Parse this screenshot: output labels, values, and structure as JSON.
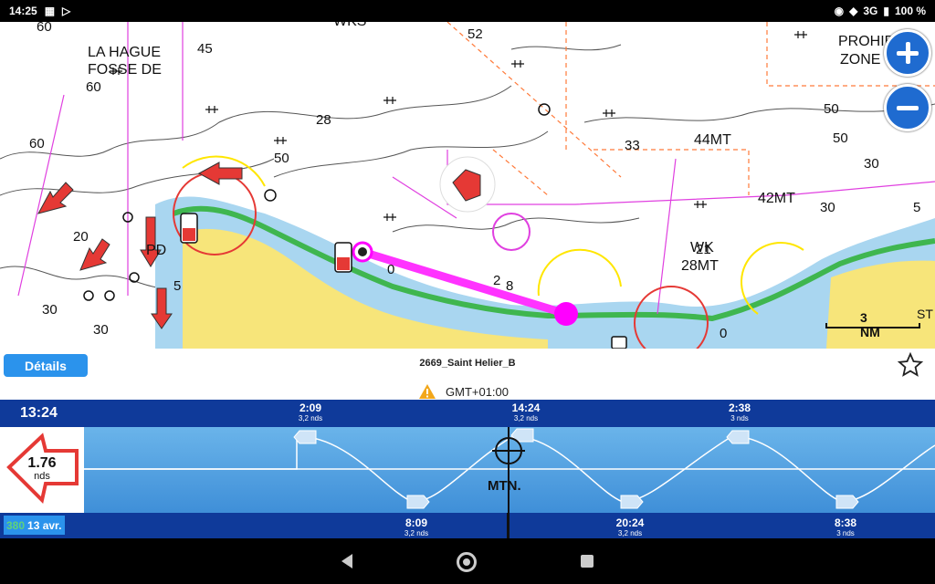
{
  "status": {
    "time": "14:25",
    "network": "3G",
    "battery": "100 %"
  },
  "map": {
    "labels": {
      "hague": "LA HAGUE",
      "fosse": "FOSSE DE",
      "prohib": "PROHIB",
      "zone": "ZONE",
      "mt44": "44MT",
      "mt42": "42MT",
      "wk": "WK",
      "mt28": "28MT",
      "pd": "PD",
      "wks": "WKS"
    },
    "depths": [
      "60",
      "45",
      "60",
      "52",
      "28",
      "50",
      "33",
      "50",
      "60",
      "20",
      "30",
      "30",
      "30",
      "50",
      "30",
      "5",
      "2",
      "8",
      "0",
      "0",
      "5",
      "21"
    ],
    "scale_label": "3 NM",
    "scale_suffix": "ST",
    "colors": {
      "land": "#f7e57a",
      "shallow": "#a9d6f0",
      "green": "#3fb64f",
      "magenta": "#ff00ff",
      "route": "#ff33ff"
    }
  },
  "infobar": {
    "details_label": "Détails",
    "station": "2669_Saint Helier_B"
  },
  "gmt": {
    "label": "GMT+01:00"
  },
  "tide": {
    "now": "13:24",
    "current_value": "1.76",
    "current_unit": "nds",
    "marker_label": "MTN.",
    "date": "13 avr.",
    "moon": "380",
    "top_events": [
      {
        "time": "2:09",
        "speed": "3,2 nds"
      },
      {
        "time": "14:24",
        "speed": "3,2 nds"
      },
      {
        "time": "2:38",
        "speed": "3 nds"
      }
    ],
    "bottom_events": [
      {
        "time": "8:09",
        "speed": "3,2 nds"
      },
      {
        "time": "20:24",
        "speed": "3,2 nds"
      },
      {
        "time": "8:38",
        "speed": "3 nds"
      }
    ]
  }
}
